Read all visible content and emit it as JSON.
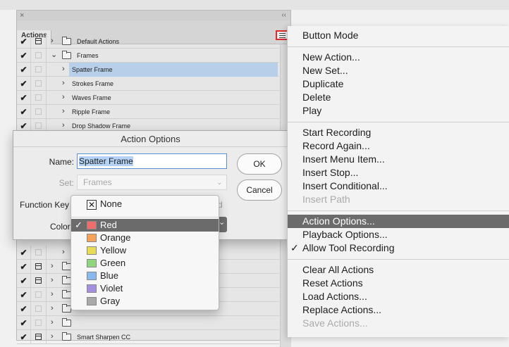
{
  "panel": {
    "tab_label": "Actions",
    "close_glyph": "×",
    "collapse_glyph": "‹‹",
    "rows_top": [
      {
        "check": "✔",
        "has_dialog": true,
        "expanded": false,
        "type": "set",
        "label": "Default Actions"
      },
      {
        "check": "✔",
        "has_dialog": false,
        "expanded": true,
        "type": "set",
        "label": "Frames"
      },
      {
        "check": "✔",
        "has_dialog": false,
        "expanded": false,
        "type": "action",
        "label": "Spatter Frame",
        "selected": true
      },
      {
        "check": "✔",
        "has_dialog": false,
        "expanded": false,
        "type": "action",
        "label": "Strokes Frame"
      },
      {
        "check": "✔",
        "has_dialog": false,
        "expanded": false,
        "type": "action",
        "label": "Waves Frame"
      },
      {
        "check": "✔",
        "has_dialog": false,
        "expanded": false,
        "type": "action",
        "label": "Ripple Frame"
      },
      {
        "check": "✔",
        "has_dialog": false,
        "expanded": false,
        "type": "action",
        "label": "Drop Shadow Frame"
      }
    ],
    "rows_bottom": [
      {
        "check": "✔",
        "has_dialog": false,
        "type": "action",
        "label": ""
      },
      {
        "check": "✔",
        "has_dialog": true,
        "type": "set",
        "label": ""
      },
      {
        "check": "✔",
        "has_dialog": true,
        "type": "set",
        "label": ""
      },
      {
        "check": "✔",
        "has_dialog": false,
        "type": "set",
        "label": ""
      },
      {
        "check": "✔",
        "has_dialog": false,
        "type": "set",
        "label": ""
      },
      {
        "check": "✔",
        "has_dialog": false,
        "type": "set",
        "label": ""
      },
      {
        "check": "✔",
        "has_dialog": true,
        "type": "set",
        "label": "Smart Sharpen CC"
      }
    ]
  },
  "dialog": {
    "title": "Action Options",
    "name_label": "Name:",
    "name_value": "Spatter Frame",
    "set_label": "Set:",
    "set_value": "Frames",
    "function_key_label": "Function Key",
    "function_key_tail": "d",
    "color_label": "Color",
    "ok_label": "OK",
    "cancel_label": "Cancel"
  },
  "color_dropdown": {
    "none_label": "None",
    "options": [
      {
        "label": "Red",
        "color": "#f26b6b",
        "selected": true
      },
      {
        "label": "Orange",
        "color": "#f6a35a"
      },
      {
        "label": "Yellow",
        "color": "#eadb55"
      },
      {
        "label": "Green",
        "color": "#8fd67f"
      },
      {
        "label": "Blue",
        "color": "#8ab9ef"
      },
      {
        "label": "Violet",
        "color": "#a48fe0"
      },
      {
        "label": "Gray",
        "color": "#a9a9a9"
      }
    ]
  },
  "menu": {
    "groups": [
      [
        {
          "label": "Button Mode"
        }
      ],
      [
        {
          "label": "New Action..."
        },
        {
          "label": "New Set..."
        },
        {
          "label": "Duplicate"
        },
        {
          "label": "Delete"
        },
        {
          "label": "Play"
        }
      ],
      [
        {
          "label": "Start Recording"
        },
        {
          "label": "Record Again..."
        },
        {
          "label": "Insert Menu Item..."
        },
        {
          "label": "Insert Stop..."
        },
        {
          "label": "Insert Conditional..."
        },
        {
          "label": "Insert Path",
          "disabled": true
        }
      ],
      [
        {
          "label": "Action Options...",
          "highlighted": true
        },
        {
          "label": "Playback Options..."
        },
        {
          "label": "Allow Tool Recording",
          "checked": true
        }
      ],
      [
        {
          "label": "Clear All Actions"
        },
        {
          "label": "Reset Actions"
        },
        {
          "label": "Load Actions..."
        },
        {
          "label": "Replace Actions..."
        },
        {
          "label": "Save Actions...",
          "disabled": true
        }
      ]
    ]
  },
  "colors": {
    "selection_row": "#b7cfe9",
    "highlight": "#6b6b6b",
    "menu_button_outline": "#e3282a"
  }
}
